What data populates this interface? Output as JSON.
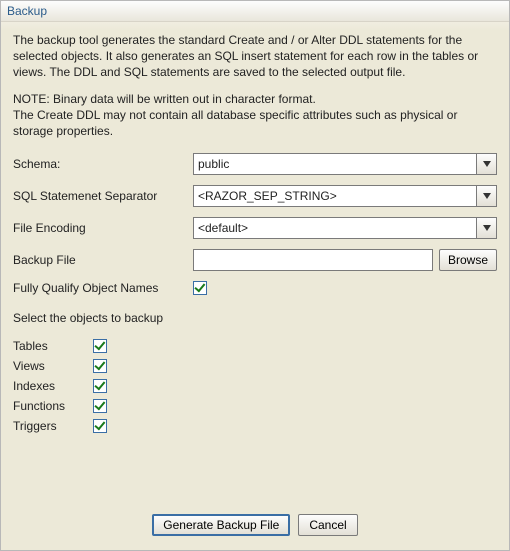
{
  "window": {
    "title": "Backup"
  },
  "description": "The backup tool generates the standard Create and / or Alter DDL statements for the selected objects. It also generates an SQL insert statement for each row in the tables or views. The DDL and SQL statements are saved to the selected output file.",
  "note": "NOTE: Binary data will be written out in character format.\nThe Create DDL may not contain all database specific attributes such as physical or storage properties.",
  "fields": {
    "schema": {
      "label": "Schema:",
      "value": "public"
    },
    "separator": {
      "label": "SQL Statemenet Separator",
      "value": "<RAZOR_SEP_STRING>"
    },
    "encoding": {
      "label": "File Encoding",
      "value": "<default>"
    },
    "backup_file": {
      "label": "Backup File",
      "value": "",
      "browse": "Browse"
    },
    "qualify": {
      "label": "Fully Qualify Object Names",
      "checked": true
    }
  },
  "objects_label": "Select the objects to backup",
  "objects": {
    "tables": {
      "label": "Tables",
      "checked": true
    },
    "views": {
      "label": "Views",
      "checked": true
    },
    "indexes": {
      "label": "Indexes",
      "checked": true
    },
    "functions": {
      "label": "Functions",
      "checked": true
    },
    "triggers": {
      "label": "Triggers",
      "checked": true
    }
  },
  "buttons": {
    "generate": "Generate Backup File",
    "cancel": "Cancel"
  }
}
